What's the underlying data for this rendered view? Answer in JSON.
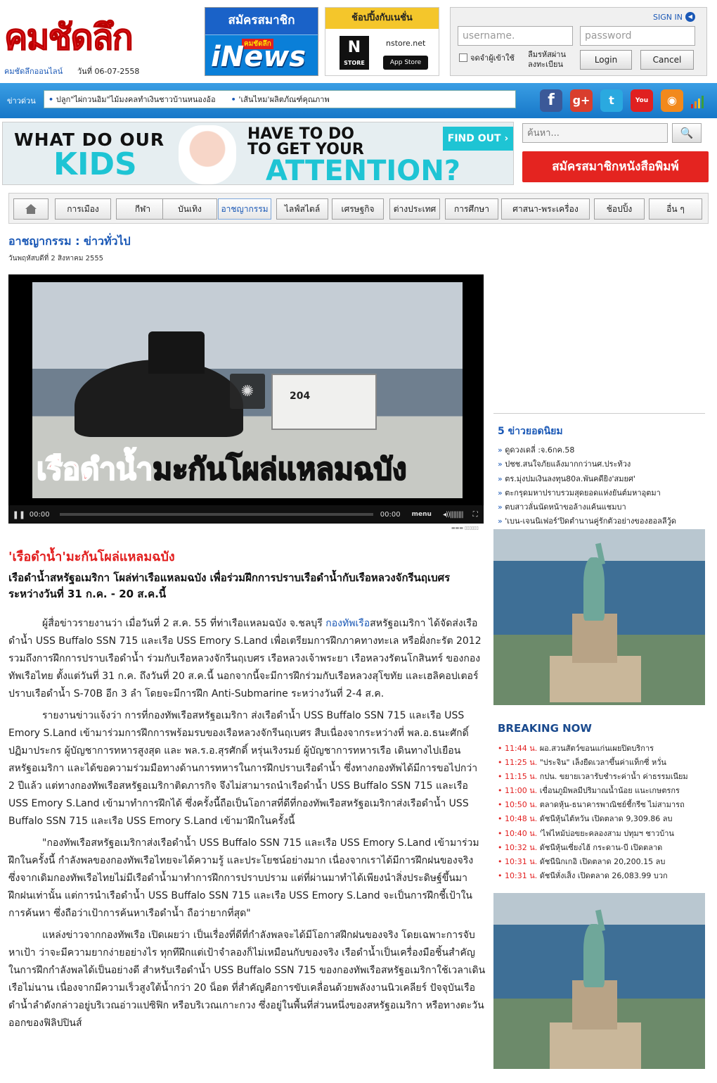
{
  "header": {
    "logo_text": "คมชัดลึก",
    "site_link": "คมชัดลึกออนไลน์",
    "date": "วันที่ 06-07-2558",
    "inews": {
      "top": "สมัครสมาชิก",
      "mini": "คมชัดลึก",
      "word": "iNews"
    },
    "nstore": {
      "top": "ช้อปปิ้งกับเนชั่น",
      "logo": "N",
      "logo_small": "STORE",
      "url": "nstore.net",
      "appstore": "App Store"
    },
    "login": {
      "sign_in": "SIGN IN",
      "username_placeholder": "username.",
      "password_placeholder": "password",
      "remember": "จดจำผู้เข้าใช้",
      "forgot": "ลืมรหัสผ่าน ลงทะเบียน",
      "login_button": "Login",
      "cancel_button": "Cancel"
    }
  },
  "newsbar": {
    "label": "ข่าวด่วน",
    "items": [
      "ปลูก\"ไผ่กวนอิม\"ไม้มงคลทำเงินชาวบ้านหนองอ้อ",
      "'เส้นไหม'ผลิตภัณฑ์คุณภาพ"
    ],
    "social": {
      "fb": "f",
      "gp": "g+",
      "tw": "t",
      "yt": "You Tube",
      "rss": "◉"
    }
  },
  "ad": {
    "what": "WHAT DO OUR",
    "kids": "KIDS",
    "have": "HAVE TO DO",
    "toget": "TO GET YOUR",
    "attention": "ATTENTION?",
    "findout": "FIND OUT ›",
    "search_placeholder": "ค้นหา...",
    "search_icon": "🔍",
    "subscribe": "สมัครสมาชิกหนังสือพิมพ์"
  },
  "nav": {
    "items": [
      "การเมือง",
      "กีฬา",
      "บันเทิง",
      "อาชญากรรม",
      "ไลฟ์สไตล์",
      "เศรษฐกิจ",
      "ต่างประเทศ",
      "การศึกษา",
      "ศาสนา-พระเครื่อง",
      "ช้อปปิ้ง",
      "อื่น ๆ"
    ],
    "active": "อาชญากรรม"
  },
  "article": {
    "section": "อาชญากรรม : ข่าวทั่วไป",
    "pub_date": "วันพฤหัสบดีที่ 2 สิงหาคม 2555",
    "video": {
      "tug_number": "204",
      "caption_red": "เรือดำน้ำ",
      "caption_white": "มะกันโผล่แหลมฉบัง",
      "time_current": "00:00",
      "time_total": "00:00",
      "menu": "menu",
      "volume": "◂))||||||||",
      "fullscreen": "⛶",
      "pause": "❚❚",
      "credit": "▬▬▬ ▯▯▯▯▯▯"
    },
    "headline": "'เรือดำน้ำ'มะกันโผล่แหลมฉบัง",
    "lead": "เรือดำน้ำสหรัฐอเมริกา โผล่ท่าเรือแหลมฉบัง เพื่อร่วมฝึกการปราบเรือดำน้ำกับเรือหลวงจักรีนฤเบศร ระหว่างวันที่ 31 ก.ค. - 20 ส.ค.นี้",
    "p1_a": "ผู้สื่อข่าวรายงานว่า  เมื่อวันที่ 2 ส.ค. 55  ที่ท่าเรือแหลมฉบัง จ.ชลบุรี  ",
    "p1_tag": "กองทัพเรือ",
    "p1_b": "สหรัฐอเมริกา ได้จัดส่งเรือดำน้ำ USS Buffalo SSN 715 และเรือ USS Emory S.Land เพื่อเตรียมการฝึกภาคทางทะเล หรือฝั่งกะรัต 2012 รวมถึงการฝึกการปราบเรือดำน้ำ ร่วมกับเรือหลวงจักรีนฤเบศร เรือหลวงเจ้าพระยา เรือหลวงรัตนโกสินทร์ ของกองทัพเรือไทย ตั้งแต่วันที่ 31 ก.ค. ถึงวันที่ 20 ส.ค.นี้ นอกจากนี้จะมีการฝึกร่วมกับเรือหลวงสุโขทัย และเฮลิคอปเตอร์ปราบเรือดำน้ำ S-70B อีก 3 ลำ โดยจะมีการฝึก Anti-Submarine ระหว่างวันที่ 2-4 ส.ค.",
    "p2": "รายงานข่าวแจ้งว่า การที่กองทัพเรือสหรัฐอเมริกา ส่งเรือดำน้ำ USS Buffalo SSN 715 และเรือ USS Emory S.Land เข้ามาร่วมการฝึกการพร้อมรบของเรือหลวงจักรีนฤเบศร สืบเนื่องจากระหว่างที่ พล.อ.ธนะศักดิ์ ปฏิมาประกร ผู้บัญชาการทหารสูงสุด และ พล.ร.อ.สุรศักดิ์ หรุ่นเริงรมย์ ผู้บัญชาการทหารเรือ เดินทางไปเยือนสหรัฐอเมริกา และได้ขอความร่วมมือทางด้านการทหารในการฝึกปราบเรือดำน้ำ ซึ่งทางกองทัพได้มีการขอไปกว่า 2 ปีแล้ว แต่ทางกองทัพเรือสหรัฐอเมริกาติดภารกิจ จึงไม่สามารถนำเรือดำน้ำ USS Buffalo SSN 715 และเรือ USS Emory S.Land เข้ามาทำการฝึกได้ ซึ่งครั้งนี้ถือเป็นโอกาสที่ดีที่กองทัพเรือสหรัฐอเมริกาส่งเรือดำน้ำ USS Buffalo SSN 715 และเรือ USS Emory S.Land เข้ามาฝึกในครั้งนี้",
    "p3": "\"กองทัพเรือสหรัฐอเมริกาส่งเรือดำน้ำ USS Buffalo SSN 715 และเรือ USS Emory S.Land เข้ามาร่วมฝึกในครั้งนี้ กำลังพลของกองทัพเรือไทยจะได้ความรู้ และประโยชน์อย่างมาก เนื่องจากเราได้มีการฝึกฝนของจริง ซึ่งจากเดิมกองทัพเรือไทยไม่มีเรือดำน้ำมาทำการฝึกการปราบปราม แต่ที่ผ่านมาทำได้เพียงนำสิ่งประดิษฐ์ขึ้นมาฝึกฝนเท่านั้น แต่การนำเรือดำน้ำ USS Buffalo SSN 715 และเรือ USS Emory S.Land จะเป็นการฝึกชี้เป้าในการค้นหา ซึ่งถือว่าเป้าการค้นหาเรือดำน้ำ ถือว่ายากที่สุด\"",
    "p4": "แหล่งข่าวจากกองทัพเรือ เปิดเผยว่า เป็นเรื่องที่ดีที่กำลังพลจะได้มีโอกาสฝึกฝนของจริง โดยเฉพาะการจับหาเป้า ว่าจะมีความยากง่ายอย่างไร ทุกทีฝึกแต่เป้าจำลองก็ไม่เหมือนกับของจริง เรือดำน้ำเป็นเครื่องมือชิ้นสำคัญในการฝึกกำลังพลได้เป็นอย่างดี สำหรับเรือดำน้ำ USS Buffalo SSN 715 ของกองทัพเรือสหรัฐอเมริกาใช้เวลาเดินเรือไม่นาน เนื่องจากมีความเร็วสูงใต้น้ำกว่า 20 น็อต ที่สำคัญคือการขับเคลื่อนด้วยพลังงานนิวเคลียร์ ปัจจุบันเรือดำน้ำลำดังกล่าวอยู่บริเวณอ่าวแปซิฟิก หรือบริเวณเกาะกวง ซึ่งอยู่ในพื้นที่ส่วนหนึ่งของสหรัฐอเมริกา หรือทางตะวันออกของฟิลิปปินส์"
  },
  "popular": {
    "title": "5 ข่าวยอดนิยม",
    "items": [
      "ดูดวงเดลี่ :จ.6กค.58",
      "ปชช.สนใจภัยแล้งมากกว่านศ.ประท้วง",
      "ตร.มุ่งปมเงินลงทุน80ล.พันคดียิง'สมยศ'",
      "ตะกรุดมหาปราบรวมสุดยอดแห่งยันต์มหาอุตมา",
      "ตบสาวลั่นนัดหน้าขอล้างแค้นแชมบา",
      "'เบน-เจนนิเฟอร์'ปิดตำนานคู่รักตัวอย่างของฮอลลีวู้ด"
    ]
  },
  "breaking": {
    "title": "BREAKING NOW",
    "items": [
      {
        "time": "11:44 น.",
        "text": "ผอ.สวนสัตว์ขอนแก่นเผยปิดบริการ"
      },
      {
        "time": "11:25 น.",
        "text": "\"ประจิน\" เล็งยืดเวลาขึ้นค่าแท็กซี่ หวั่น"
      },
      {
        "time": "11:15 น.",
        "text": "กปน. ขยายเวลารับชำระค่าน้ำ ค่าธรรมเนียม"
      },
      {
        "time": "11:00 น.",
        "text": "เขื่อนภูมิพลมีปริมาณน้ำน้อย แนะเกษตรกร"
      },
      {
        "time": "10:50 น.",
        "text": "ตลาดหุ้น-ธนาคารพาณิชย์ชี้กรีซ ไม่สามารถ"
      },
      {
        "time": "10:48 น.",
        "text": "ดัชนีหุ้นไต้หวัน เปิดตลาด 9,309.86 ลบ"
      },
      {
        "time": "10:40 น.",
        "text": "'ไฟไหม้บ่อขยะคลองสาม ปทุมฯ ชาวบ้าน"
      },
      {
        "time": "10:32 น.",
        "text": "ดัชนีหุ้นเซี่ยงไฮ้ กระดาน-บี เปิดตลาด"
      },
      {
        "time": "10:31 น.",
        "text": "ดัชนีนิกเกอิ เปิดตลาด 20,200.15 ลบ"
      },
      {
        "time": "10:31 น.",
        "text": "ดัชนีหั่งเส็ง เปิดตลาด 26,083.99 บวก"
      }
    ]
  },
  "colors": {
    "brand_red": "#e4141e",
    "link_blue": "#1a58b6",
    "bar_blue": "#1677c8",
    "accent_cyan": "#1ec4d4"
  }
}
